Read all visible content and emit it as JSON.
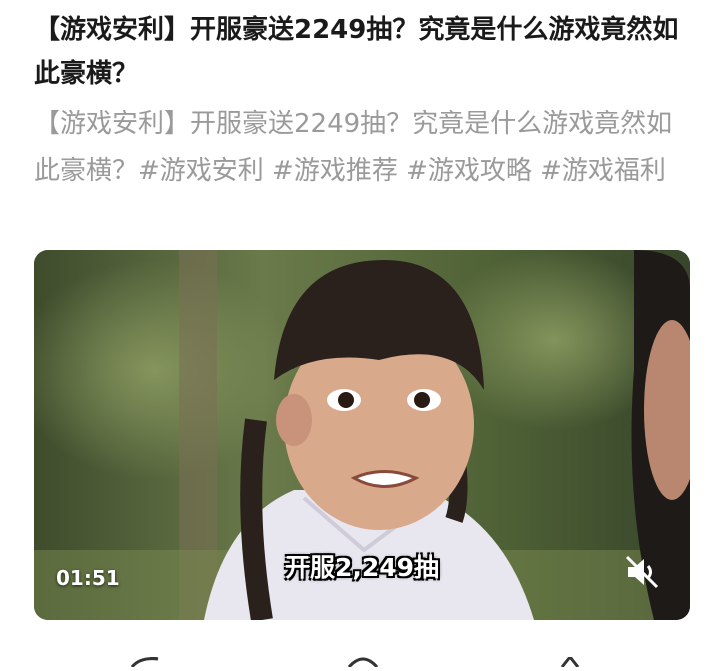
{
  "post": {
    "title": "【游戏安利】开服豪送2249抽？究竟是什么游戏竟然如此豪横？",
    "description": "【游戏安利】开服豪送2249抽？究竟是什么游戏竟然如此豪横？#游戏安利 #游戏推荐 #游戏攻略 #游戏福利"
  },
  "video": {
    "duration": "01:51",
    "subtitle": "开服2,249抽",
    "mute_icon": "volume-mute-icon"
  },
  "bottom_bar": {
    "icons": [
      "share-icon",
      "comment-icon",
      "like-icon"
    ]
  }
}
